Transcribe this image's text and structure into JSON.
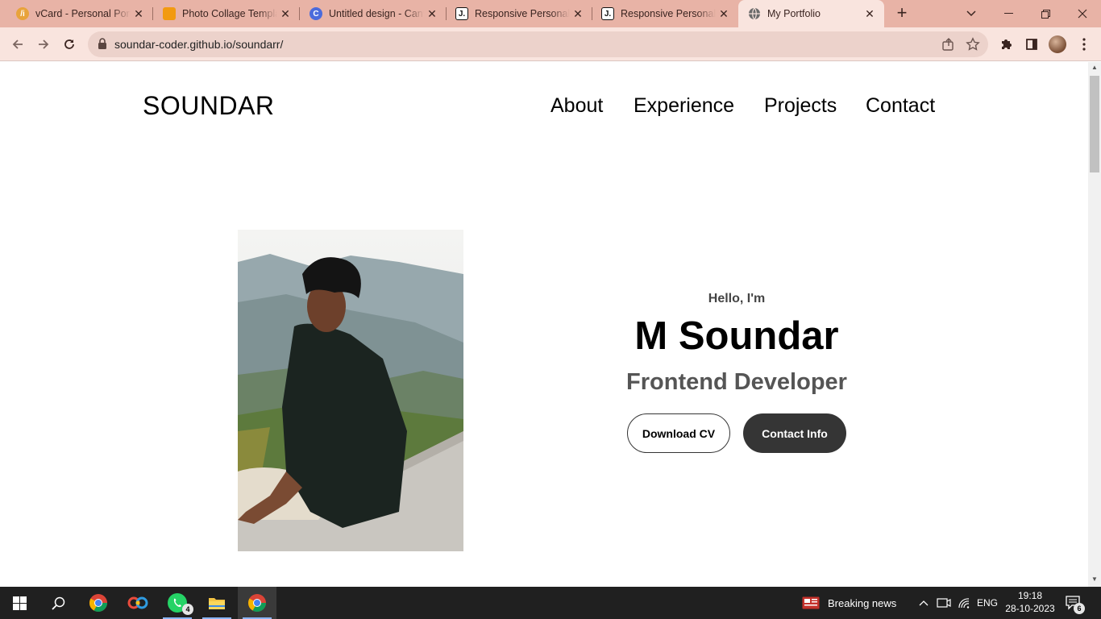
{
  "browser": {
    "tabs": [
      {
        "title": "vCard - Personal Portfolio",
        "icon": "vcard-icon",
        "color": "#e8a33b"
      },
      {
        "title": "Photo Collage Template",
        "icon": "collage-icon",
        "color": "#f29a11"
      },
      {
        "title": "Untitled design - Canva",
        "icon": "canva-icon",
        "color": "#4b6bdc"
      },
      {
        "title": "Responsive Personal Portfolio",
        "icon": "j-icon",
        "color": "#111111"
      },
      {
        "title": "Responsive Personal Portfolio",
        "icon": "j-icon",
        "color": "#111111"
      },
      {
        "title": "My Portfolio",
        "icon": "globe-icon",
        "color": "#6a6a6a"
      }
    ],
    "url": "soundar-coder.github.io/soundarr/"
  },
  "site": {
    "logo": "SOUNDAR",
    "nav": [
      "About",
      "Experience",
      "Projects",
      "Contact"
    ],
    "hero": {
      "greeting": "Hello, I'm",
      "name": "M Soundar",
      "role": "Frontend Developer",
      "download_label": "Download CV",
      "contact_label": "Contact Info"
    }
  },
  "taskbar": {
    "whatsapp_badge": "4",
    "news": "Breaking news",
    "language": "ENG",
    "time": "19:18",
    "date": "28-10-2023",
    "notifications": "6"
  }
}
